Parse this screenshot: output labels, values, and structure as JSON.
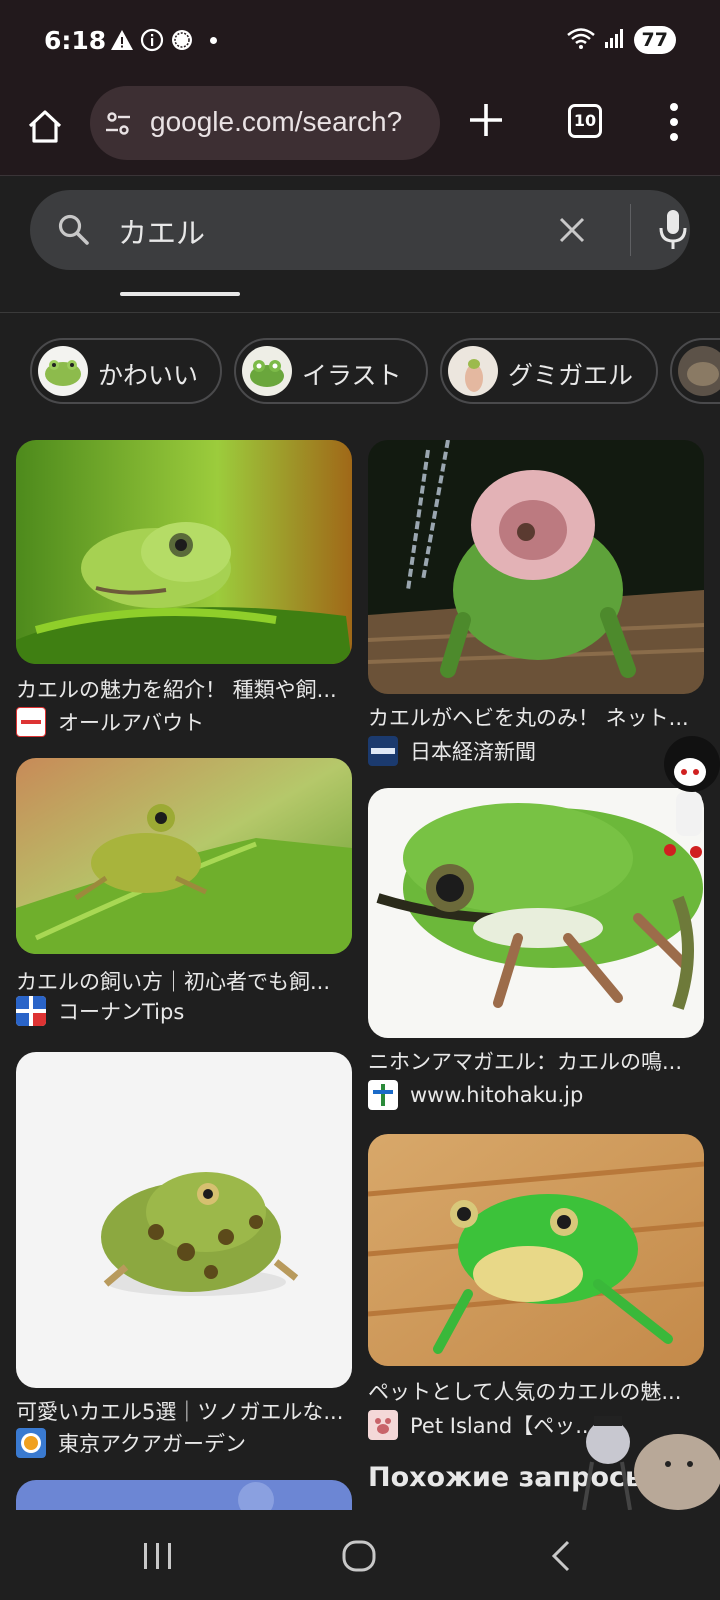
{
  "status_bar": {
    "time": "6:18",
    "battery": "77",
    "left_icons": [
      "warning-icon",
      "info-icon",
      "app-icon"
    ],
    "right_icons": [
      "wifi-icon",
      "signal-icon"
    ]
  },
  "browser": {
    "url": "google.com/search?",
    "tab_count": "10"
  },
  "search": {
    "query": "カエル"
  },
  "chips": [
    {
      "label": "かわいい"
    },
    {
      "label": "イラスト"
    },
    {
      "label": "グミガエル"
    }
  ],
  "results": [
    {
      "title": "カエルの魅力を紹介！ 種類や飼...",
      "source": "オールアバウト"
    },
    {
      "title": "カエルがヘビを丸のみ！ ネット...",
      "source": "日本経済新聞"
    },
    {
      "title": "カエルの飼い方｜初心者でも飼...",
      "source": "コーナンTips"
    },
    {
      "title": "ニホンアマガエル：カエルの鳴...",
      "source": "www.hitohaku.jp"
    },
    {
      "title": "可愛いカエル5選｜ツノガエルな...",
      "source": "東京アクアガーデン"
    },
    {
      "title": "ペットとして人気のカエルの魅...",
      "source": "Pet Island【ペッ..."
    }
  ],
  "related_heading": "Похожие запросы",
  "colors": {
    "background": "#1f1f1f",
    "toolbar": "#22191c",
    "urlbar": "#3d2f33",
    "searchbox": "#3c3d3f"
  }
}
